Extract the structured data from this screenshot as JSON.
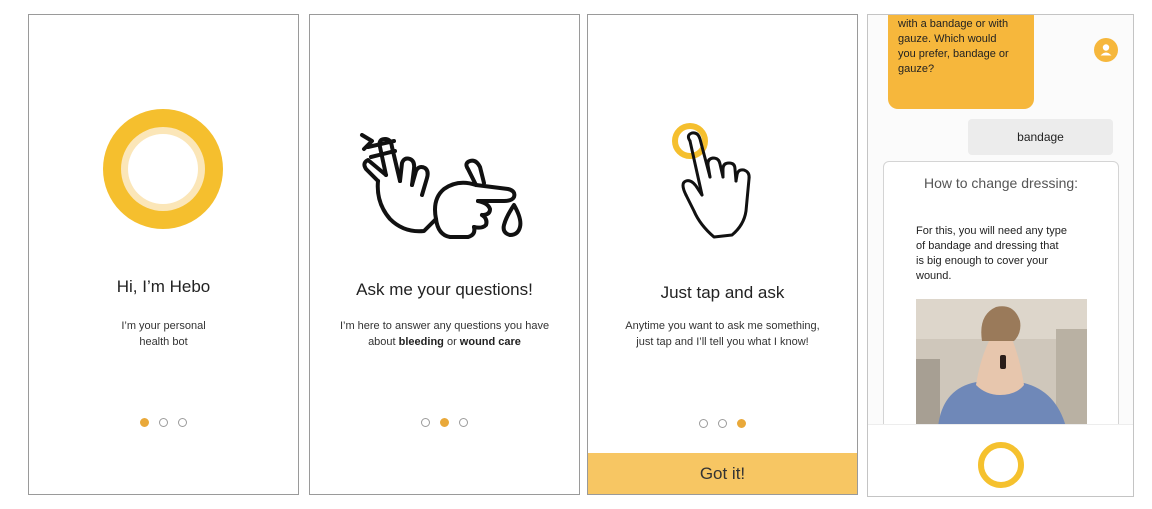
{
  "colors": {
    "accent": "#f5bf2e",
    "dot_active": "#e9a93a",
    "button": "#f7c663"
  },
  "screen1": {
    "title": "Hi, I’m Hebo",
    "subtitle_line1": "I’m your personal",
    "subtitle_line2": "health bot",
    "icon": "hebo-ring-icon",
    "active_page": 1
  },
  "screen2": {
    "title": "Ask me your questions!",
    "subtitle_line1": "I’m here to answer any questions you have",
    "subtitle_pre": "about",
    "subtitle_bold1": "bleeding",
    "subtitle_mid": "or",
    "subtitle_bold2": "wound care",
    "icon": "bandaged-hands-icon",
    "active_page": 2
  },
  "screen3": {
    "title": "Just tap and ask",
    "subtitle_line1": "Anytime you want to ask me something,",
    "subtitle_line2": "just tap and I’ll tell you what I know!",
    "icon": "tap-hand-icon",
    "button_label": "Got it!",
    "active_page": 3
  },
  "screen4": {
    "bot_message_lines": [
      "with a bandage or with",
      "gauze. Which would",
      "you prefer, bandage or",
      "gauze?"
    ],
    "user_message": "bandage",
    "avatar_icon": "user-avatar-icon",
    "card": {
      "title": "How to change dressing:",
      "body_lines": [
        "For this, you will need any type",
        "of bandage and dressing that",
        "is big enough to cover your",
        "wound."
      ],
      "image": "photo-of-neck-wound"
    },
    "mic_icon": "hebo-mic-button-icon"
  }
}
